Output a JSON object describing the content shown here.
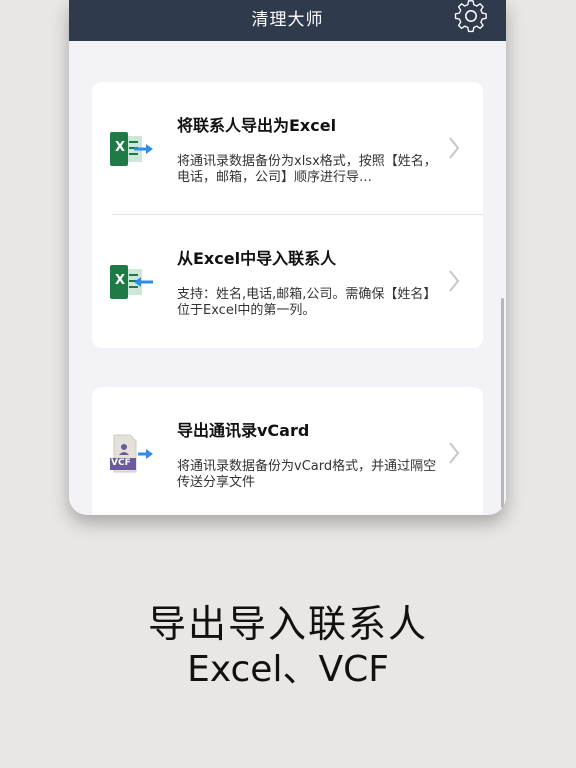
{
  "nav": {
    "title": "清理大师",
    "settings_icon": "gear-icon"
  },
  "items": [
    {
      "title": "将联系人导出为Excel",
      "desc": "将通讯录数据备份为xlsx格式，按照【姓名，电话，邮箱，公司】顺序进行导…",
      "icon": "excel-export-icon",
      "badge": "X"
    },
    {
      "title": "从Excel中导入联系人",
      "desc": "支持：姓名,电话,邮箱,公司。需确保【姓名】位于Excel中的第一列。",
      "icon": "excel-import-icon",
      "badge": "X"
    },
    {
      "title": "导出通讯录vCard",
      "desc": "将通讯录数据备份为vCard格式，并通过隔空传送分享文件",
      "icon": "vcard-export-icon",
      "badge": "VCF"
    }
  ],
  "caption": {
    "line1": "导出导入联系人",
    "line2": "Excel、VCF"
  },
  "colors": {
    "navbar": "#2f3a4d",
    "excel_green": "#1f7a45",
    "arrow_blue": "#2d8cf0",
    "vcf_purple": "#6b5a9e"
  }
}
